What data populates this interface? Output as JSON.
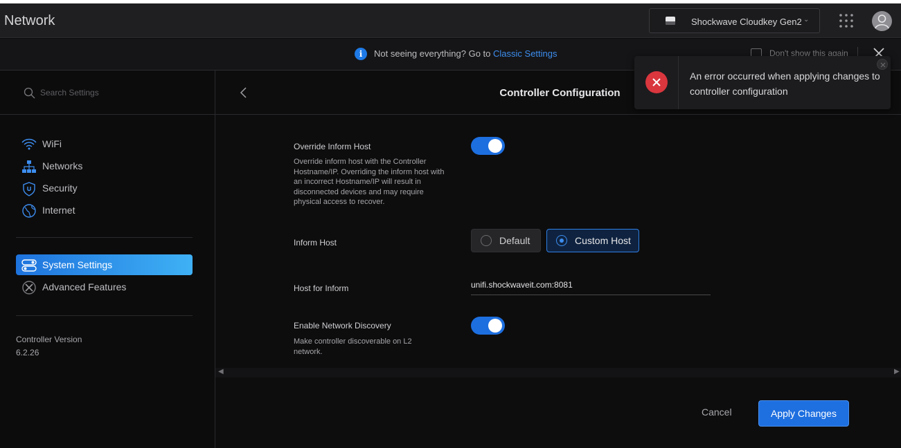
{
  "header": {
    "app_title": "Network",
    "device_name": "Shockwave Cloudkey Gen2"
  },
  "banner": {
    "text": "Not seeing everything? Go to",
    "link": "Classic Settings",
    "checkbox_label": "Don't show this again"
  },
  "sidebar": {
    "search_placeholder": "Search Settings",
    "items": [
      {
        "label": "WiFi",
        "icon": "wifi-icon"
      },
      {
        "label": "Networks",
        "icon": "networks-icon"
      },
      {
        "label": "Security",
        "icon": "shield-icon"
      },
      {
        "label": "Internet",
        "icon": "globe-icon"
      }
    ],
    "items2": [
      {
        "label": "System Settings",
        "icon": "system-settings-icon",
        "active": true
      },
      {
        "label": "Advanced Features",
        "icon": "advanced-features-icon"
      }
    ],
    "version_label": "Controller Version",
    "version_value": "6.2.26"
  },
  "main": {
    "title": "Controller Configuration",
    "override": {
      "label": "Override Inform Host",
      "description": "Override inform host with the Controller Hostname/IP. Overriding the inform host with an incorrect Hostname/IP will result in disconnected devices and may require physical access to recover.",
      "enabled": true
    },
    "inform_host": {
      "label": "Inform Host",
      "options": [
        "Default",
        "Custom Host"
      ],
      "selected": "Custom Host"
    },
    "host_for_inform": {
      "label": "Host for Inform",
      "value": "unifi.shockwaveit.com:8081"
    },
    "discovery": {
      "label": "Enable Network Discovery",
      "description": "Make controller discoverable on L2 network.",
      "enabled": true
    },
    "cancel_label": "Cancel",
    "apply_label": "Apply Changes"
  },
  "toast": {
    "message": "An error occurred when applying changes to controller configuration"
  },
  "colors": {
    "accent": "#1e6fe0",
    "error": "#d9363e"
  }
}
